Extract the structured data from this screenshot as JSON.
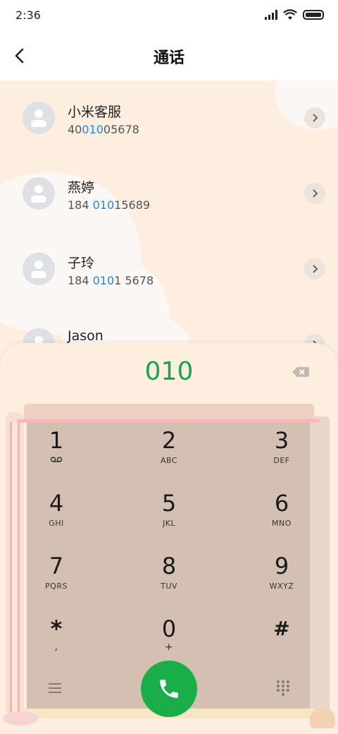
{
  "status": {
    "time": "2:36"
  },
  "header": {
    "title": "通话"
  },
  "contacts": [
    {
      "name": "小米客服",
      "num_pre": "40",
      "num_hl": "010",
      "num_post": "05678"
    },
    {
      "name": "燕婷",
      "num_pre": "184 ",
      "num_hl": "010",
      "num_post": "15689"
    },
    {
      "name": "子玲",
      "num_pre": "184 ",
      "num_hl": "010",
      "num_post": "1 5678"
    },
    {
      "name": "Jason",
      "num_pre": "",
      "num_hl": "",
      "num_post": ""
    }
  ],
  "dialer": {
    "number": "010",
    "keys": [
      {
        "digit": "1",
        "letters": ""
      },
      {
        "digit": "2",
        "letters": "ABC"
      },
      {
        "digit": "3",
        "letters": "DEF"
      },
      {
        "digit": "4",
        "letters": "GHI"
      },
      {
        "digit": "5",
        "letters": "JKL"
      },
      {
        "digit": "6",
        "letters": "MNO"
      },
      {
        "digit": "7",
        "letters": "PQRS"
      },
      {
        "digit": "8",
        "letters": "TUV"
      },
      {
        "digit": "9",
        "letters": "WXYZ"
      },
      {
        "digit": "*",
        "letters": ","
      },
      {
        "digit": "0",
        "letters": "+"
      },
      {
        "digit": "#",
        "letters": ""
      }
    ]
  },
  "icons": {
    "back": "back-arrow-icon",
    "backspace": "backspace-icon",
    "menu": "menu-icon",
    "call": "phone-icon",
    "keypad": "keypad-icon",
    "voicemail": "voicemail-icon"
  },
  "colors": {
    "accent_green": "#1aae4b",
    "highlight_blue": "#1e88e5"
  }
}
